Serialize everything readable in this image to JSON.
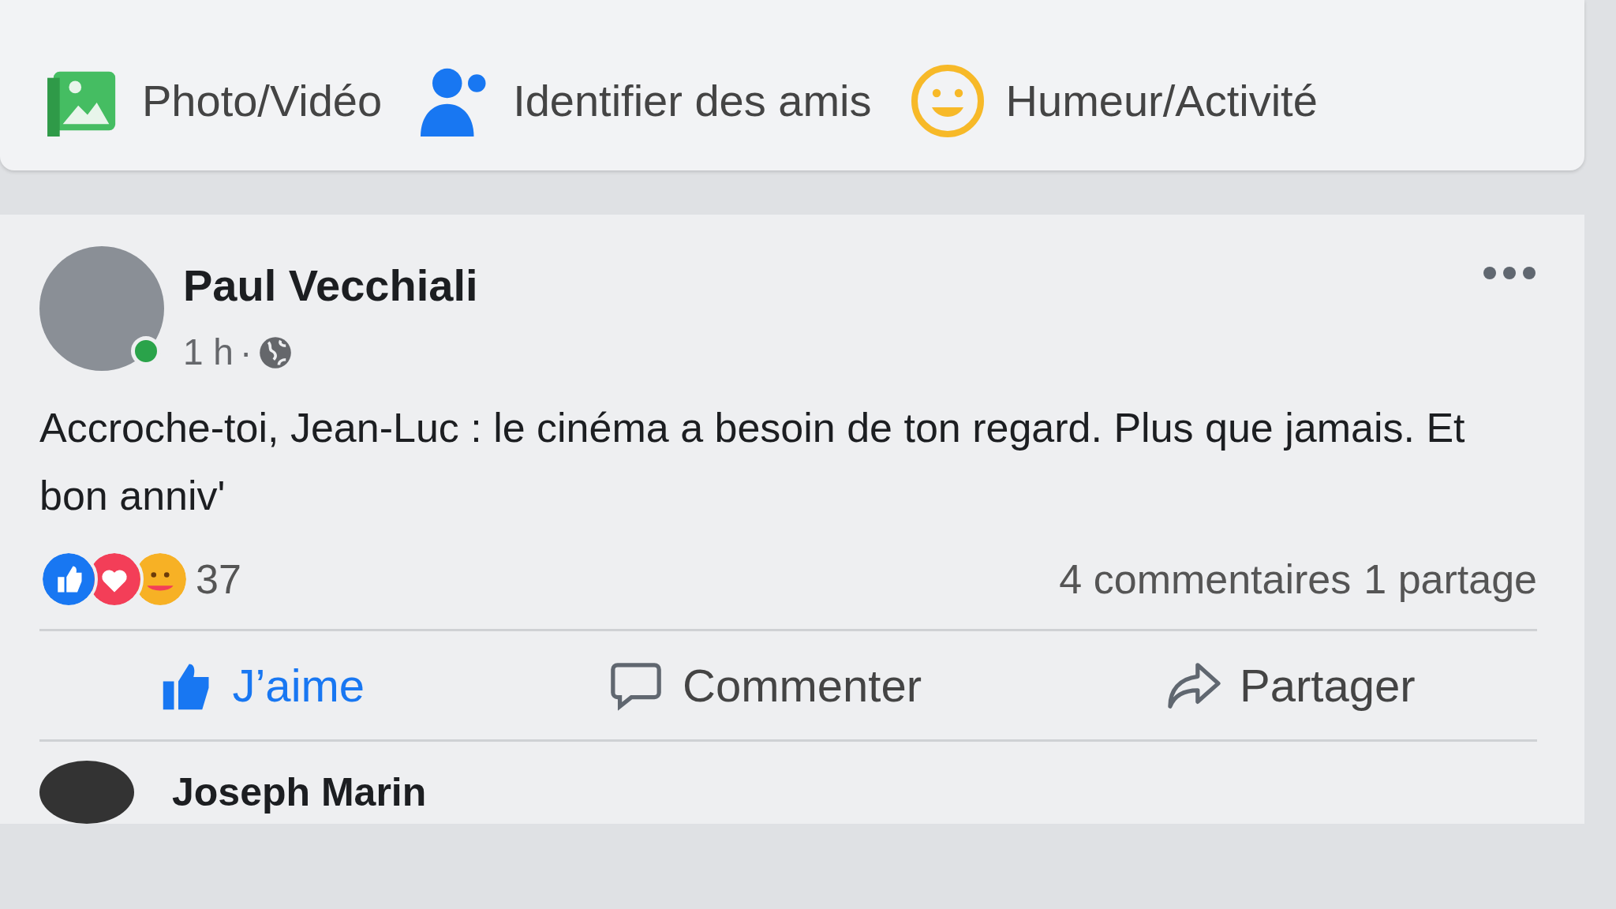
{
  "composer_actions": [
    {
      "label": "Photo/Vidéo",
      "kind": "photo"
    },
    {
      "label": "Identifier des amis",
      "kind": "tag"
    },
    {
      "label": "Humeur/Activité",
      "kind": "feeling"
    }
  ],
  "post": {
    "author": "Paul Vecchiali",
    "online": true,
    "time": "1 h",
    "separator": "·",
    "text": "Accroche-toi, Jean-Luc : le cinéma a besoin de ton regard. Plus que jamais. Et bon anniv'",
    "reactions": [
      {
        "kind": "like"
      },
      {
        "kind": "love"
      },
      {
        "kind": "care"
      }
    ],
    "reaction_count": "37",
    "comments": "4 commentaires",
    "shares": "1 partage",
    "actions": [
      {
        "label": "J’aime",
        "kind": "like",
        "selected": true
      },
      {
        "label": "Commenter",
        "kind": "comment",
        "selected": false
      },
      {
        "label": "Partager",
        "kind": "share",
        "selected": false
      }
    ]
  },
  "next_comment": {
    "author": "Joseph Marin"
  }
}
